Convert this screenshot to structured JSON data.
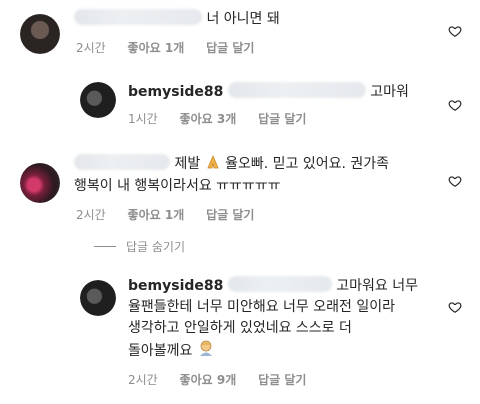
{
  "comments": [
    {
      "id": "c1",
      "text": "너 아니면 돼",
      "time": "2시간",
      "likes": "좋아요 1개",
      "reply": "답글 달기"
    },
    {
      "id": "c2",
      "username": "bemyside88",
      "text": "고마워",
      "time": "1시간",
      "likes": "좋아요 3개",
      "reply": "답글 달기"
    },
    {
      "id": "c3",
      "line1_a": "제발",
      "line1_b": "율오빠. 믿고 있어요.  권가족",
      "line2": "행복이 내 행복이라서요 ㅠㅠㅠㅠㅠ",
      "time": "2시간",
      "likes": "좋아요 1개",
      "reply": "답글 달기"
    },
    {
      "id": "c4",
      "username": "bemyside88",
      "line1": "고마워요 너무",
      "line2": "율팬들한테 너무 미안해요 너무 오래전 일이라",
      "line3": "생각하고 안일하게 있었네요 스스로 더",
      "line4": "돌아볼께요",
      "time": "2시간",
      "likes": "좋아요 9개",
      "reply": "답글 달기"
    }
  ],
  "hide_replies": "답글 숨기기",
  "icons": {
    "heart": "heart-outline-icon",
    "pray": "folded-hands-emoji",
    "emoji": "person-emoji"
  },
  "colors": {
    "text": "#262626",
    "meta": "#8e8e8e"
  }
}
